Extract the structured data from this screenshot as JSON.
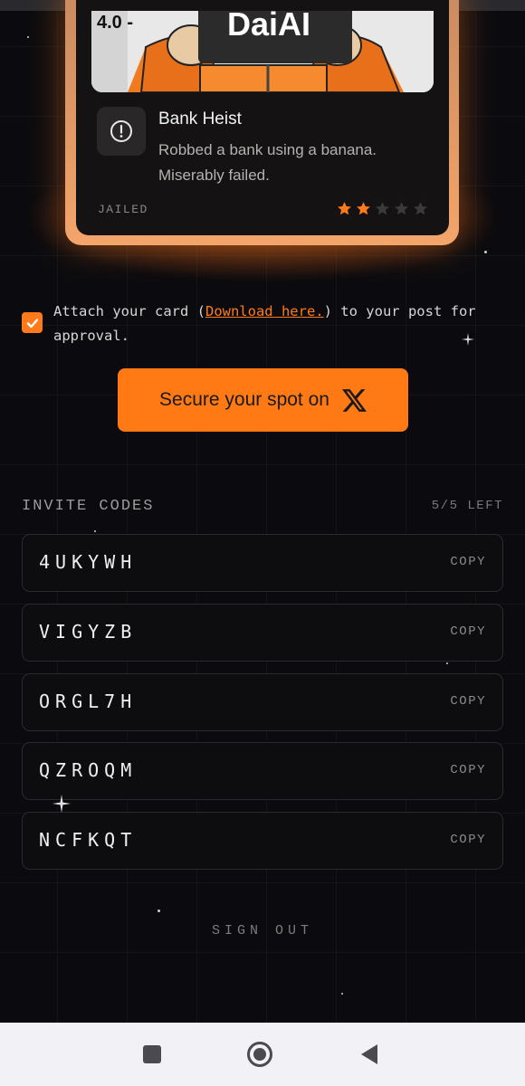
{
  "card": {
    "mugshot_height": "4.0 -",
    "mugshot_sign": "DaiAI",
    "title": "Bank Heist",
    "description": "Robbed a bank using a banana. Miserably failed.",
    "status": "JAILED",
    "rating": 2,
    "rating_max": 5
  },
  "attach": {
    "checked": true,
    "text_before": "Attach your card (",
    "link_text": "Download here.",
    "text_after": ") to your post for approval."
  },
  "cta": {
    "label": "Secure your spot on"
  },
  "invites": {
    "heading": "INVITE CODES",
    "remaining": "5/5 LEFT",
    "copy_label": "COPY",
    "codes": [
      "4UKYWH",
      "VIGYZB",
      "ORGL7H",
      "QZROQM",
      "NCFKQT"
    ]
  },
  "signout_label": "SIGN OUT",
  "colors": {
    "accent": "#ff7a14",
    "background": "#0b0b0f",
    "star_on": "#ff7a1a",
    "star_off": "#3a3a3a"
  },
  "icons": {
    "crime": "alert-circle-icon",
    "cta": "x-logo-icon",
    "nav": [
      "square-recents-icon",
      "circle-home-icon",
      "triangle-back-icon"
    ]
  }
}
